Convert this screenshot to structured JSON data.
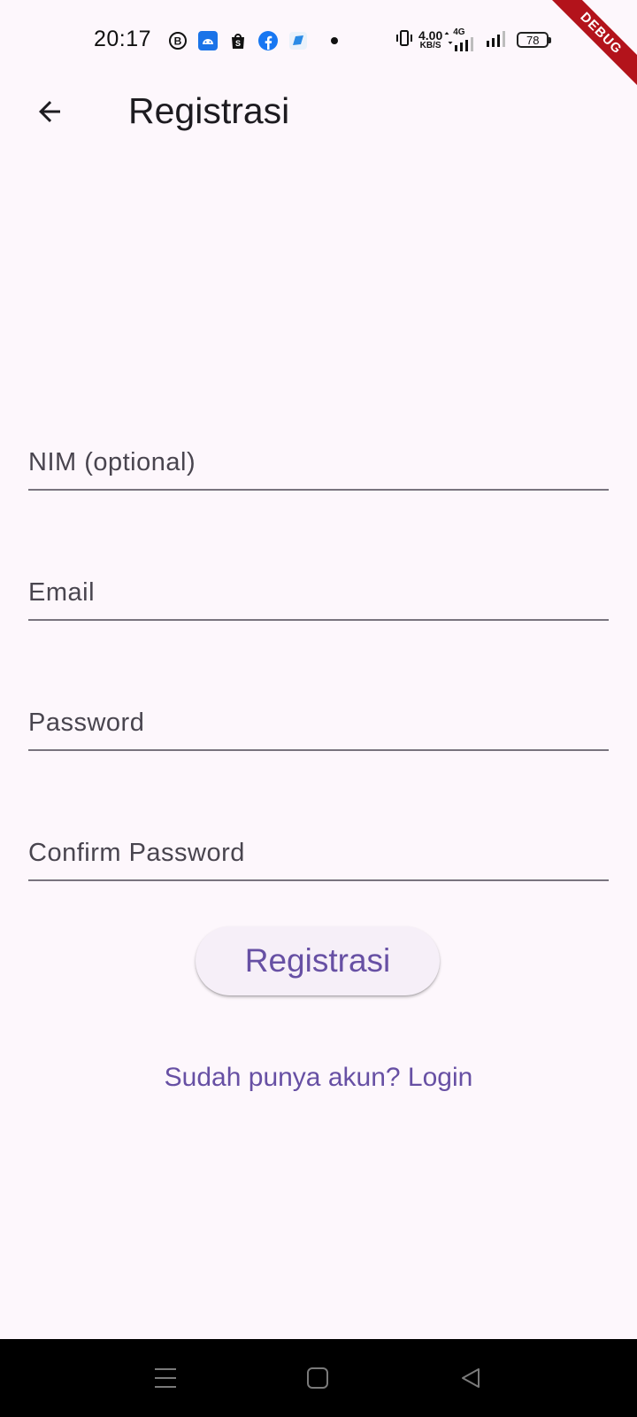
{
  "status_bar": {
    "time": "20:17",
    "net_speed_value": "4.00",
    "net_speed_unit": "KB/S",
    "network_type": "4G",
    "battery_level": "78",
    "notification_icons": [
      "b-circle-icon",
      "android-icon",
      "shopee-bag-icon",
      "facebook-icon",
      "blue-app-icon"
    ]
  },
  "debug_banner": "DEBUG",
  "app_bar": {
    "title": "Registrasi"
  },
  "form": {
    "fields": [
      {
        "placeholder": "NIM (optional)",
        "value": ""
      },
      {
        "placeholder": "Email",
        "value": ""
      },
      {
        "placeholder": "Password",
        "value": ""
      },
      {
        "placeholder": "Confirm Password",
        "value": ""
      }
    ],
    "submit_label": "Registrasi",
    "login_link": "Sudah punya akun? Login"
  },
  "colors": {
    "background": "#fdf7fc",
    "accent": "#6750a4",
    "underline": "#79747e",
    "debug_banner": "#b3131b"
  }
}
